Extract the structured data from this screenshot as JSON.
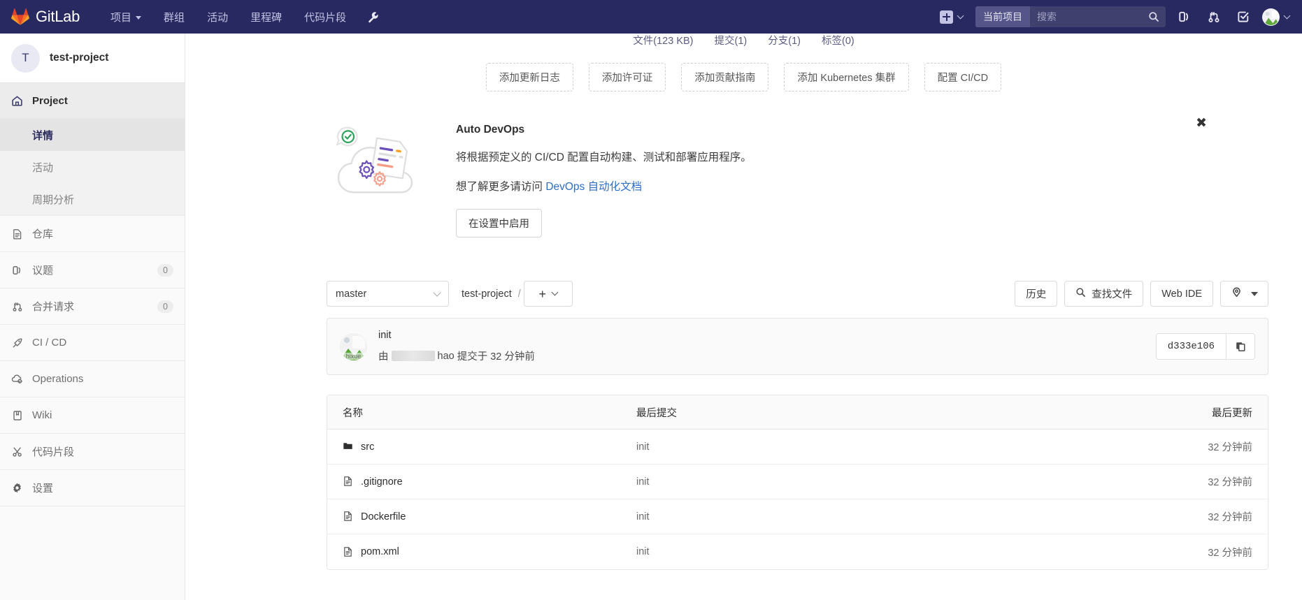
{
  "navbar": {
    "brand": "GitLab",
    "brand_icon": "gitlab-tanuki-logo",
    "links": [
      {
        "label": "项目",
        "name": "nav-projects",
        "caret": true
      },
      {
        "label": "群组",
        "name": "nav-groups",
        "caret": false
      },
      {
        "label": "活动",
        "name": "nav-activity",
        "caret": false
      },
      {
        "label": "里程碑",
        "name": "nav-milestones",
        "caret": false
      },
      {
        "label": "代码片段",
        "name": "nav-snippets",
        "caret": false
      }
    ],
    "wrench_icon": "wrench-icon",
    "create_icon": "plus-square-icon",
    "search": {
      "scope_label": "当前项目",
      "placeholder": "搜索",
      "value": "",
      "icon": "search-icon"
    },
    "icons": [
      {
        "name": "issues-icon",
        "title": "议题"
      },
      {
        "name": "merge-requests-icon",
        "title": "合并请求"
      },
      {
        "name": "todos-icon",
        "title": "待办事项"
      }
    ],
    "avatar_icon": "user-avatar",
    "avatar_caret": "chevron-down-icon"
  },
  "sidebar": {
    "project_initial": "T",
    "project_name": "test-project",
    "groups": [
      {
        "item": {
          "label": "Project",
          "icon": "home-icon",
          "name": "sidebar-item-project",
          "active": true
        },
        "sub": [
          {
            "label": "详情",
            "name": "sidebar-subitem-details",
            "active": true
          },
          {
            "label": "活动",
            "name": "sidebar-subitem-activity",
            "active": false
          },
          {
            "label": "周期分析",
            "name": "sidebar-subitem-cycle-analytics",
            "active": false
          }
        ]
      },
      {
        "item": {
          "label": "仓库",
          "icon": "document-icon",
          "name": "sidebar-item-repository"
        },
        "sub": []
      },
      {
        "item": {
          "label": "议题",
          "icon": "issues-icon",
          "name": "sidebar-item-issues",
          "count": "0"
        },
        "sub": []
      },
      {
        "item": {
          "label": "合并请求",
          "icon": "merge-request-icon",
          "name": "sidebar-item-merge-requests",
          "count": "0"
        },
        "sub": []
      },
      {
        "item": {
          "label": "CI / CD",
          "icon": "rocket-icon",
          "name": "sidebar-item-cicd"
        },
        "sub": []
      },
      {
        "item": {
          "label": "Operations",
          "icon": "cloud-gear-icon",
          "name": "sidebar-item-operations"
        },
        "sub": []
      },
      {
        "item": {
          "label": "Wiki",
          "icon": "book-icon",
          "name": "sidebar-item-wiki"
        },
        "sub": []
      },
      {
        "item": {
          "label": "代码片段",
          "icon": "scissors-icon",
          "name": "sidebar-item-snippets"
        },
        "sub": []
      },
      {
        "item": {
          "label": "设置",
          "icon": "gear-icon",
          "name": "sidebar-item-settings"
        },
        "sub": []
      }
    ]
  },
  "stats": [
    "文件(123 KB)",
    "提交(1)",
    "分支(1)",
    "标签(0)"
  ],
  "quick_actions": [
    {
      "label": "添加更新日志",
      "name": "add-changelog-button"
    },
    {
      "label": "添加许可证",
      "name": "add-license-button"
    },
    {
      "label": "添加贡献指南",
      "name": "add-contribution-guide-button"
    },
    {
      "label": "添加 Kubernetes 集群",
      "name": "add-kubernetes-cluster-button"
    },
    {
      "label": "配置 CI/CD",
      "name": "setup-cicd-button"
    }
  ],
  "auto_devops": {
    "title": "Auto DevOps",
    "description": "将根据预定义的 CI/CD 配置自动构建、测试和部署应用程序。",
    "more_prefix": "想了解更多请访问 ",
    "link_text": "DevOps 自动化文档",
    "button_label": "在设置中启用",
    "close_label": "✖",
    "illustration_icon": "auto-devops-cloud-illustration"
  },
  "repo_toolbar": {
    "branch": "master",
    "breadcrumb_root": "test-project",
    "breadcrumb_sep": "/",
    "add_glyph": "+",
    "history_label": "历史",
    "find_file_label": "查找文件",
    "web_ide_label": "Web IDE",
    "clone_icon": "clone-download-icon"
  },
  "commit": {
    "message": "init",
    "meta_prefix": "由",
    "author_suffix": "hao",
    "meta_suffix": "提交于 32 分钟前",
    "avatar_caption": "hixue",
    "sha": "d333e106",
    "copy_icon": "copy-icon"
  },
  "file_table": {
    "headers": {
      "name": "名称",
      "last_commit": "最后提交",
      "last_update": "最后更新"
    },
    "rows": [
      {
        "name": "src",
        "type": "folder",
        "icon": "folder-icon",
        "commit": "init",
        "updated": "32 分钟前"
      },
      {
        "name": ".gitignore",
        "type": "file",
        "icon": "file-doc-icon",
        "commit": "init",
        "updated": "32 分钟前"
      },
      {
        "name": "Dockerfile",
        "type": "file",
        "icon": "file-doc-icon",
        "commit": "init",
        "updated": "32 分钟前"
      },
      {
        "name": "pom.xml",
        "type": "file",
        "icon": "file-doc-icon",
        "commit": "init",
        "updated": "32 分钟前"
      }
    ]
  },
  "colors": {
    "navbar_bg": "#292961",
    "accent_link": "#2f6ec4",
    "sidebar_bg": "#fafafa",
    "active_sub": "#2a2a5c"
  }
}
